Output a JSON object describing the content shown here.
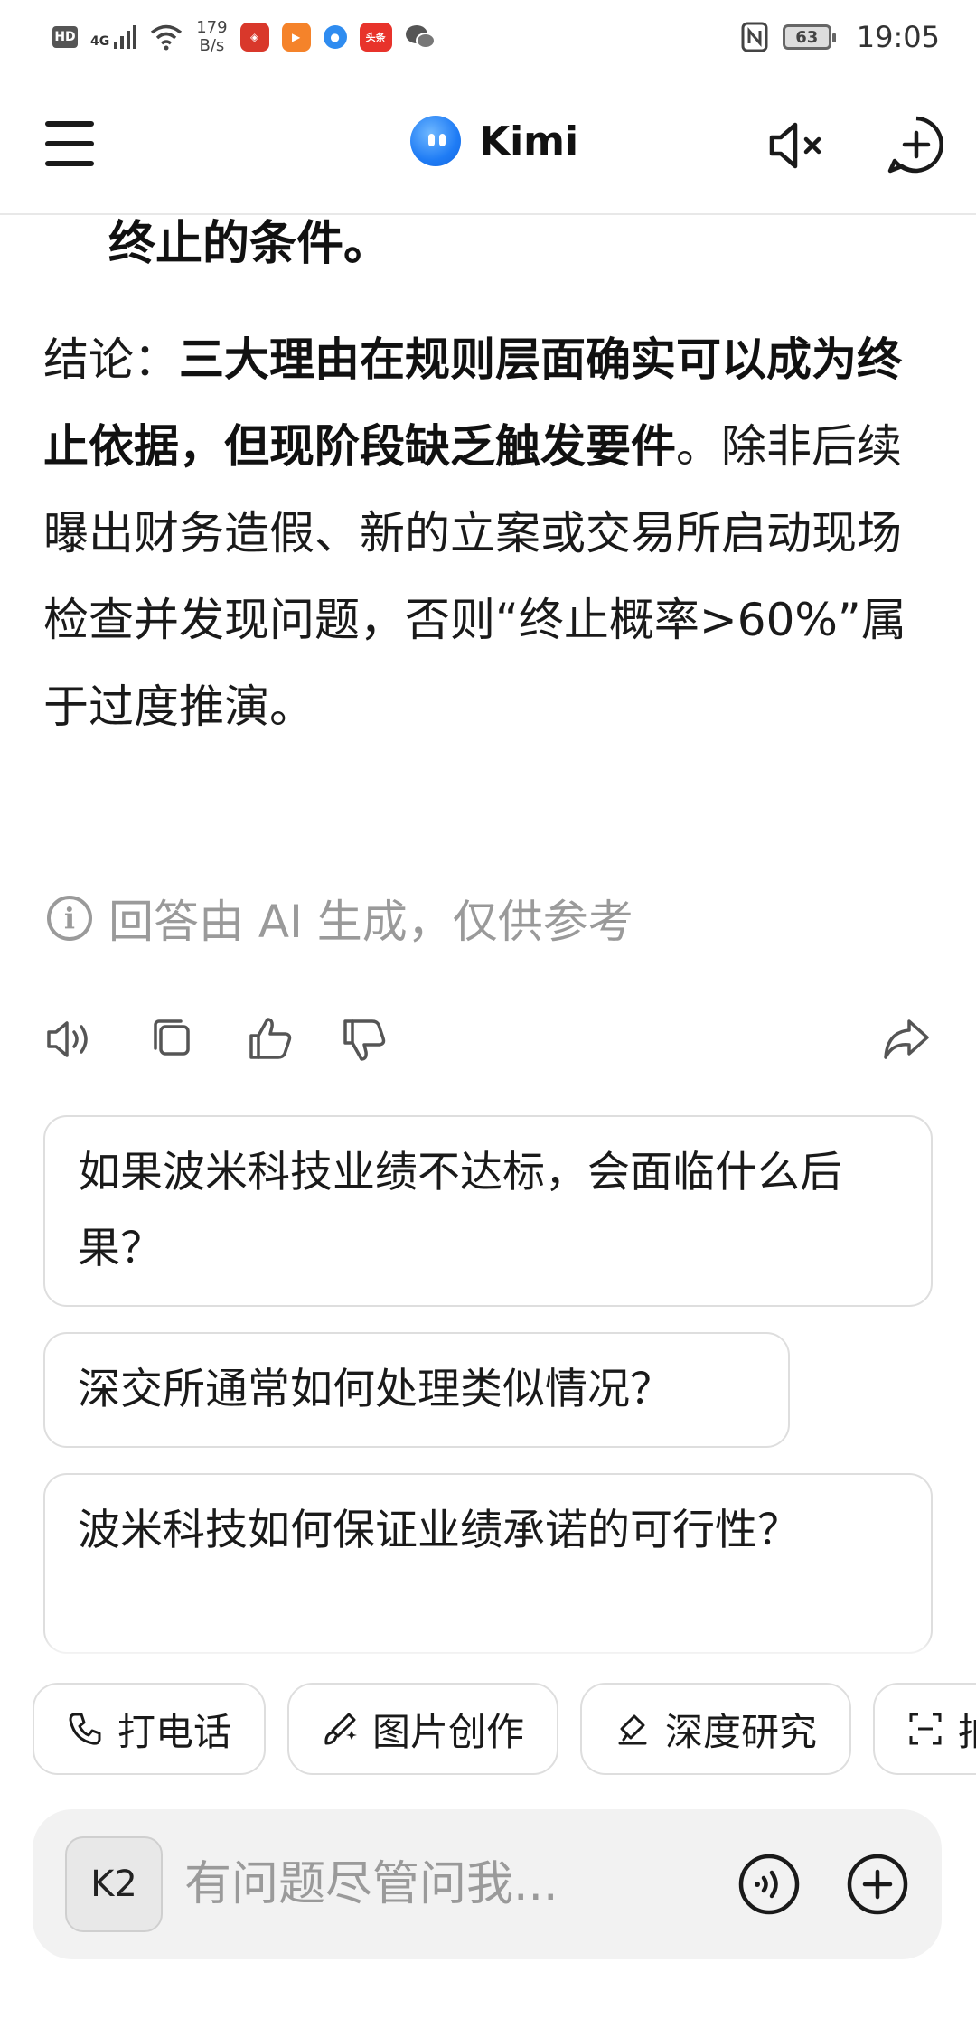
{
  "status_bar": {
    "hd": "HD",
    "network": "4G",
    "speed_value": "179",
    "speed_unit": "B/s",
    "app_icons": [
      "bank-app-icon",
      "video-app-icon",
      "browser-app-icon",
      "toutiao-app-icon",
      "wechat-app-icon"
    ],
    "toutiao": "头条",
    "battery": "63",
    "time": "19:05"
  },
  "header": {
    "title": "Kimi"
  },
  "message": {
    "partial_line": "终止的条件。",
    "conclusion_prefix": "结论：",
    "conclusion_bold": "三大理由在规则层面确实可以成为终止依据，但现阶段缺乏触发要件",
    "conclusion_rest": "。除非后续曝出财务造假、新的立案或交易所启动现场检查并发现问题，否则“终止概率>60%”属于过度推演。"
  },
  "disclaimer": "回答由 AI 生成，仅供参考",
  "suggestions": [
    "如果波米科技业绩不达标，会面临什么后果？",
    "深交所通常如何处理类似情况？",
    "波米科技如何保证业绩承诺的可行性？"
  ],
  "quick_actions": [
    {
      "label": "打电话",
      "icon": "phone-icon"
    },
    {
      "label": "图片创作",
      "icon": "brush-icon"
    },
    {
      "label": "深度研究",
      "icon": "research-icon"
    },
    {
      "label": "拍",
      "icon": "scan-icon"
    }
  ],
  "composer": {
    "model": "K2",
    "placeholder": "有问题尽管问我..."
  },
  "colors": {
    "accent": "#1f7cf5",
    "muted_text": "#9a9a9a",
    "border": "#dedede",
    "composer_bg": "#f2f2f2"
  }
}
